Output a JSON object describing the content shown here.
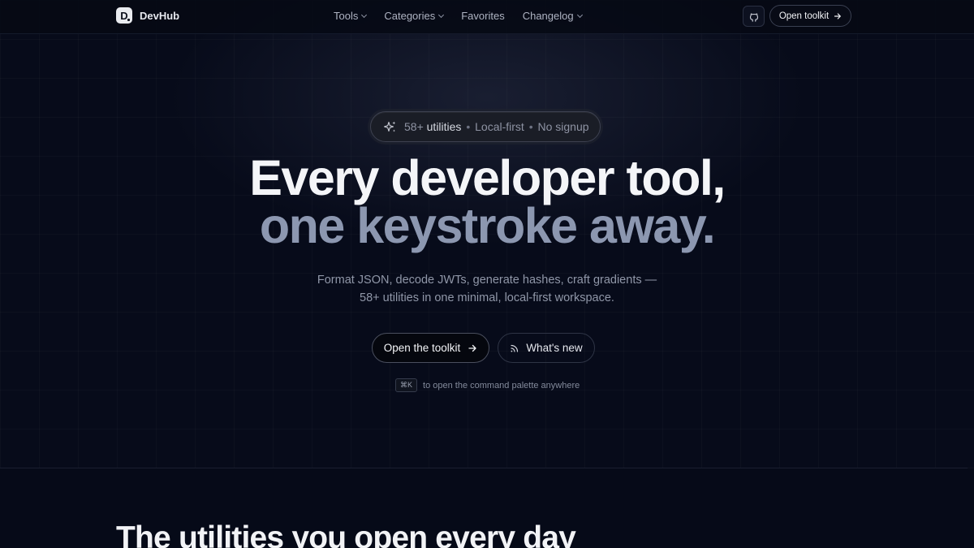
{
  "brand": {
    "name": "DevHub",
    "mark": "D"
  },
  "nav": {
    "links": [
      {
        "label": "Tools",
        "has_menu": true
      },
      {
        "label": "Categories",
        "has_menu": true
      },
      {
        "label": "Favorites",
        "has_menu": false
      },
      {
        "label": "Changelog",
        "has_menu": true
      }
    ],
    "github_icon": "github-icon",
    "cta_label": "Open toolkit"
  },
  "hero": {
    "pill": {
      "icon": "sparkles-icon",
      "count": "58+",
      "count_word": "utilities",
      "sep": "•",
      "item2": "Local-first",
      "item3": "No signup"
    },
    "headline_line1": "Every developer tool,",
    "headline_line2": "one keystroke away.",
    "subtitle_line1": "Format JSON, decode JWTs, generate hashes, craft gradients —",
    "subtitle_line2": "58+ utilities in one minimal, local-first workspace.",
    "primary_label": "Open the toolkit",
    "secondary_label": "What's new",
    "shortcut_key": "⌘K",
    "shortcut_hint": "to open the command palette anywhere"
  },
  "section": {
    "title": "The utilities you open every day"
  },
  "colors": {
    "background": "#060a18",
    "headline": "#f4f5f8",
    "headline_muted": "#8c97b0"
  }
}
